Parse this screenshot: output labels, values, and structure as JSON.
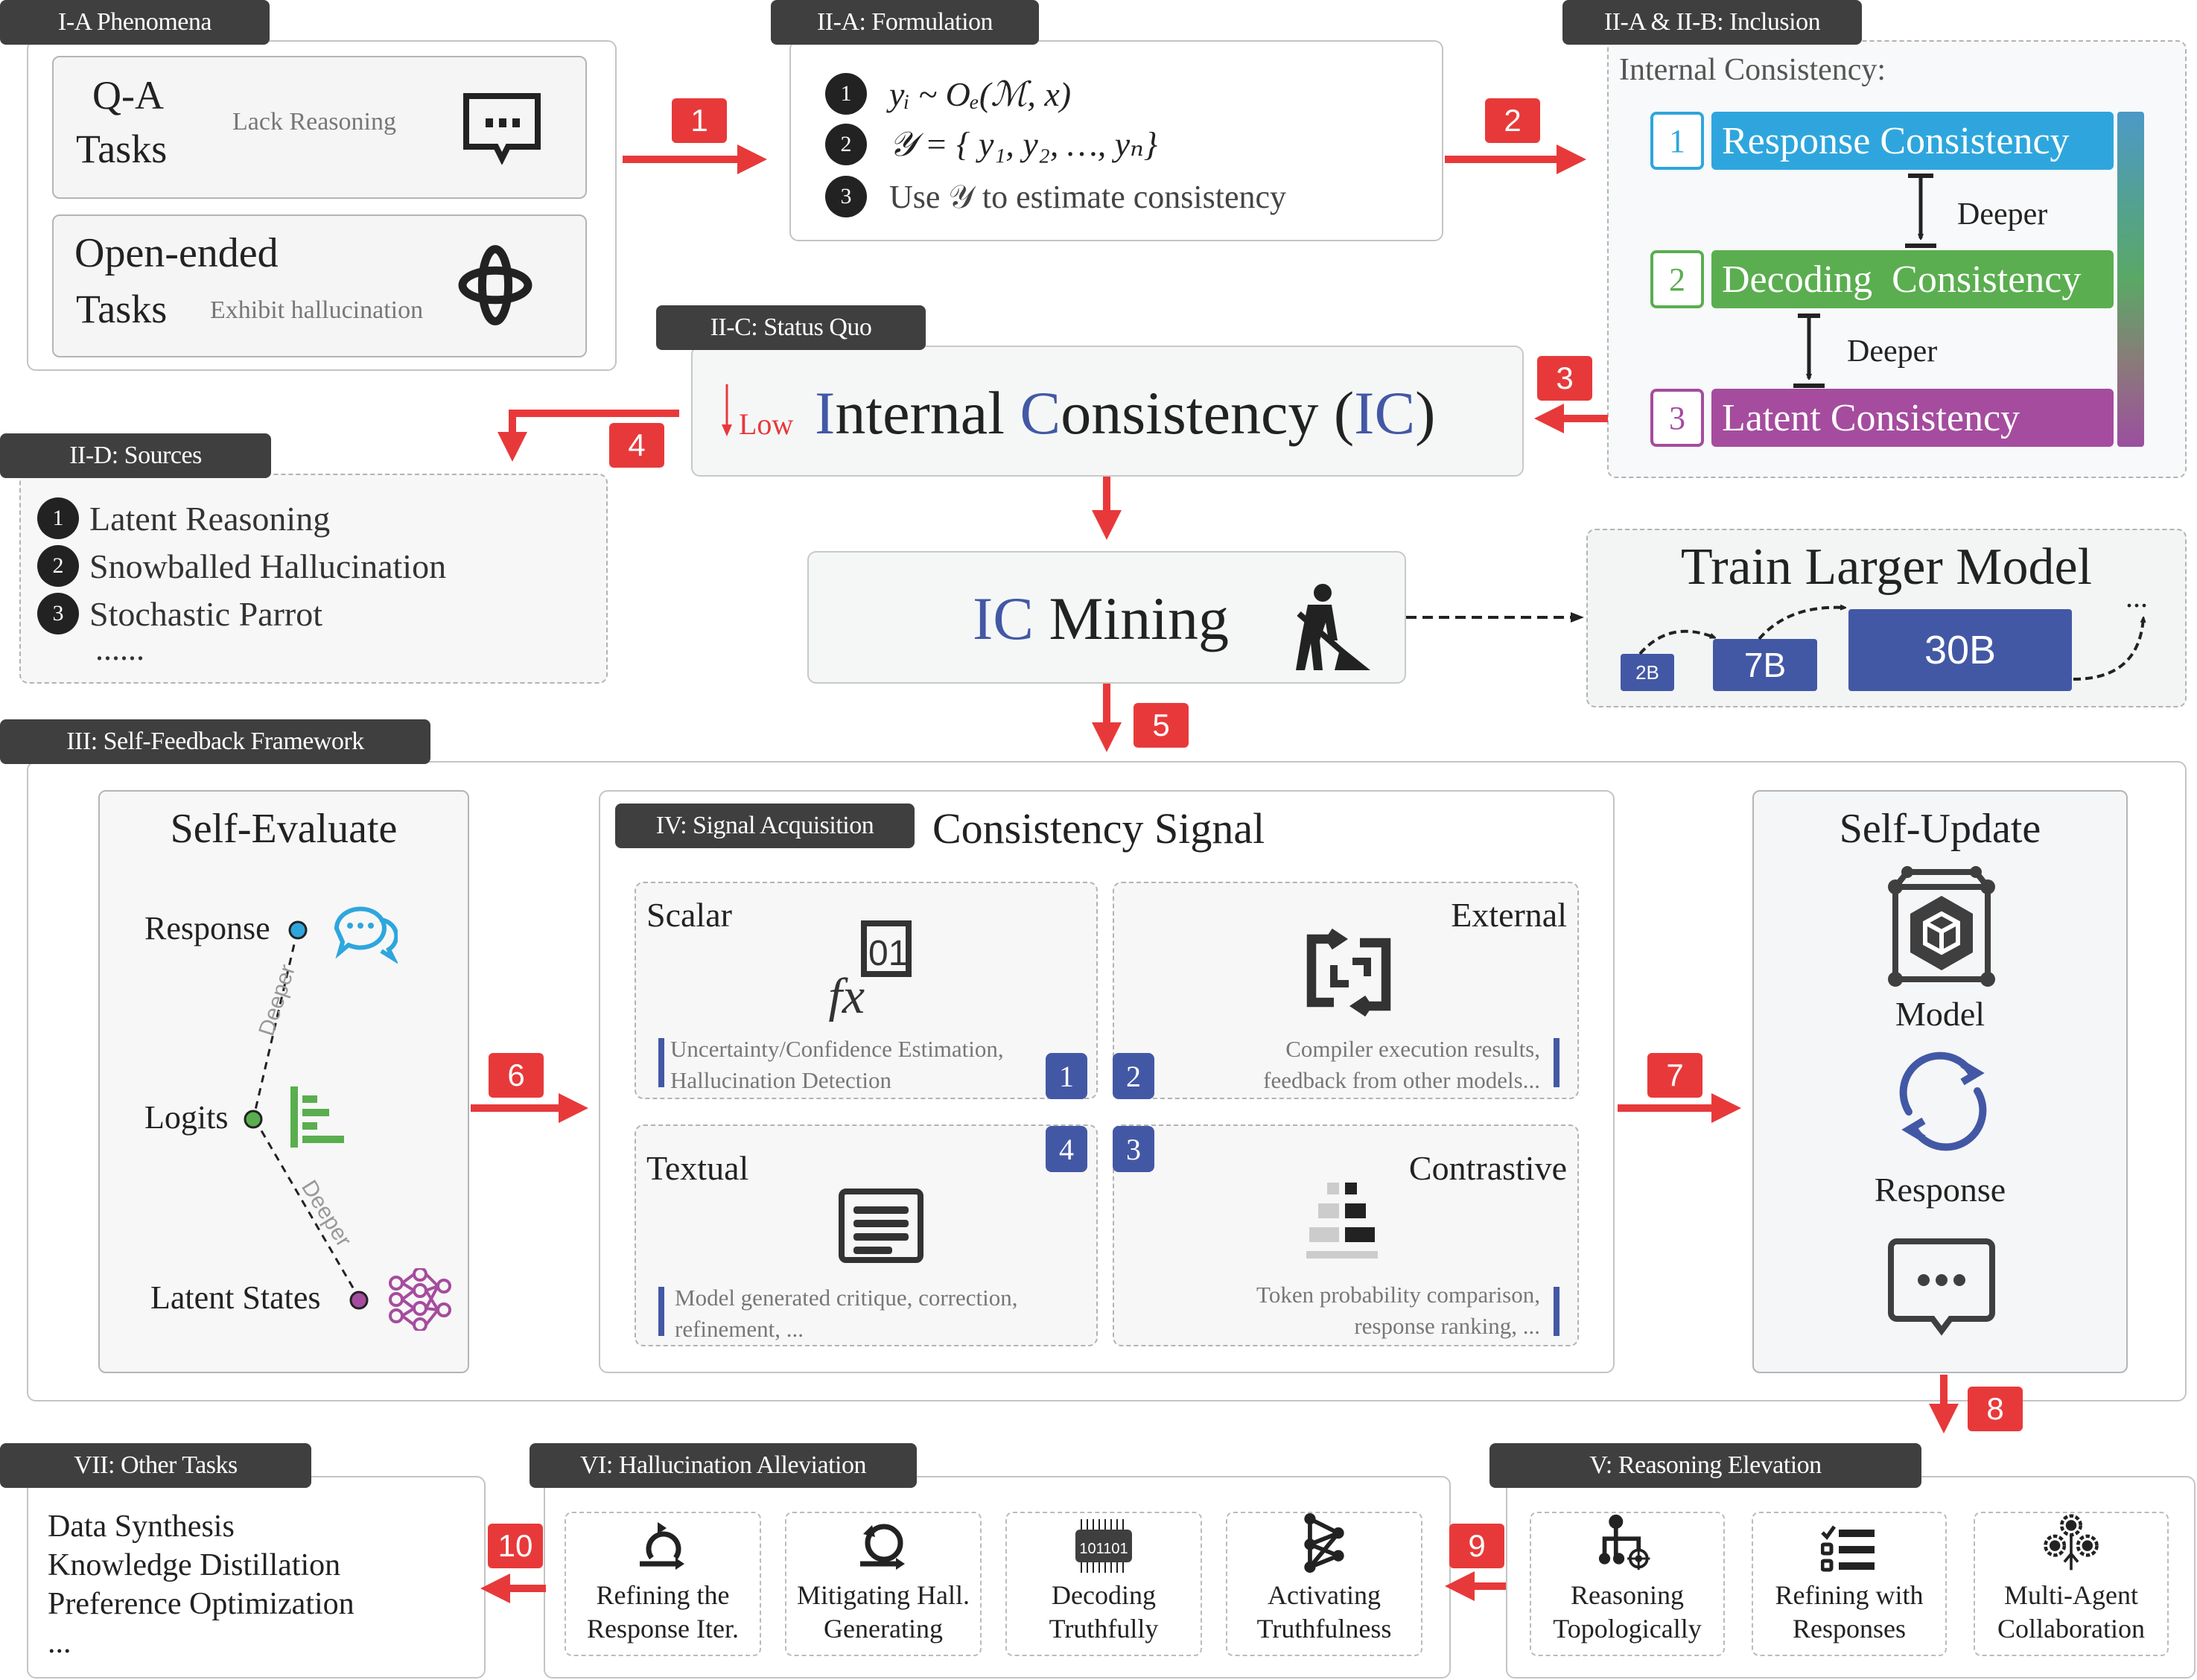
{
  "phenomena": {
    "tab": "I-A Phenomena",
    "qa": {
      "title_line1": "Q-A",
      "title_line2": "Tasks",
      "note": "Lack Reasoning",
      "icon": "chat-dots-icon"
    },
    "open": {
      "title_line1": "Open-ended",
      "title_line2": "Tasks",
      "note": "Exhibit hallucination",
      "icon": "tangle-icon"
    }
  },
  "formulation": {
    "tab": "II-A: Formulation",
    "items": [
      {
        "num": "1",
        "text": "yᵢ ~ Oₑ(ℳ, x)"
      },
      {
        "num": "2",
        "text": "𝒴 = { y₁, y₂, …, yₙ}"
      },
      {
        "num": "3",
        "text": "Use 𝒴 to estimate consistency"
      }
    ]
  },
  "inclusion": {
    "tab": "II-A & II-B: Inclusion",
    "heading": "Internal Consistency:",
    "levels": [
      {
        "num": "1",
        "label": "Response Consistency",
        "color": "#2ea6dd"
      },
      {
        "num": "2",
        "label": "Decoding  Consistency",
        "color": "#5aae4f"
      },
      {
        "num": "3",
        "label": "Latent Consistency",
        "color": "#a54c9e"
      }
    ],
    "deeper": "Deeper"
  },
  "status_quo": {
    "tab": "II-C: Status Quo",
    "low": "Low",
    "title_parts": [
      "I",
      "nternal ",
      "C",
      "onsistency (",
      "IC",
      ")"
    ]
  },
  "sources": {
    "tab": "II-D: Sources",
    "items": [
      {
        "num": "1",
        "text": "Latent Reasoning"
      },
      {
        "num": "2",
        "text": "Snowballed Hallucination"
      },
      {
        "num": "3",
        "text": "Stochastic Parrot"
      }
    ],
    "more": "......"
  },
  "mining": {
    "ic": "IC",
    "label": "Mining",
    "icon": "digging-worker-icon"
  },
  "train": {
    "title": "Train Larger Model",
    "sizes": [
      "2B",
      "7B",
      "30B"
    ],
    "more": "..."
  },
  "steps": [
    "1",
    "2",
    "3",
    "4",
    "5",
    "6",
    "7",
    "8",
    "9",
    "10"
  ],
  "framework": {
    "tab": "III: Self-Feedback Framework",
    "evaluate": {
      "title": "Self-Evaluate",
      "nodes": [
        {
          "label": "Response",
          "color": "#2ea6dd"
        },
        {
          "label": "Logits",
          "color": "#5aae4f"
        },
        {
          "label": "Latent States",
          "color": "#a54c9e"
        }
      ],
      "deeper": "Deeper"
    },
    "signal": {
      "tab": "IV: Signal Acquisition",
      "title": "Consistency Signal",
      "quadrants": [
        {
          "name": "Scalar",
          "num": "1",
          "desc": [
            "Uncertainty/Confidence  Estimation,",
            "Hallucination Detection"
          ]
        },
        {
          "name": "External",
          "num": "2",
          "desc": [
            "Compiler execution results,",
            "feedback from other models..."
          ]
        },
        {
          "name": "Contrastive",
          "num": "3",
          "desc": [
            "Token probability comparison,",
            "response ranking, ..."
          ]
        },
        {
          "name": "Textual",
          "num": "4",
          "desc": [
            "Model generated critique, correction,",
            "refinement, ..."
          ]
        }
      ]
    },
    "update": {
      "title": "Self-Update",
      "model": "Model",
      "response": "Response"
    }
  },
  "other_tasks": {
    "tab": "VII: Other Tasks",
    "items": [
      "Data Synthesis",
      "Knowledge Distillation",
      "Preference Optimization",
      "..."
    ]
  },
  "hallucination": {
    "tab": "VI: Hallucination Alleviation",
    "items": [
      {
        "line1": "Refining the",
        "line2": "Response Iter.",
        "icon": "loop-arrow-icon"
      },
      {
        "line1": "Mitigating Hall.",
        "line2": "Generating",
        "icon": "cycle-arrow-icon"
      },
      {
        "line1": "Decoding",
        "line2": "Truthfully",
        "icon": "chip-icon",
        "chip_text": "101101"
      },
      {
        "line1": "Activating",
        "line2": "Truthfulness",
        "icon": "network-icon"
      }
    ]
  },
  "reasoning": {
    "tab": "V: Reasoning Elevation",
    "items": [
      {
        "line1": "Reasoning",
        "line2": "Topologically",
        "icon": "tree-target-icon"
      },
      {
        "line1": "Refining with",
        "line2": "Responses",
        "icon": "checklist-icon"
      },
      {
        "line1": "Multi-Agent",
        "line2": "Collaboration",
        "icon": "agents-icon"
      }
    ]
  }
}
